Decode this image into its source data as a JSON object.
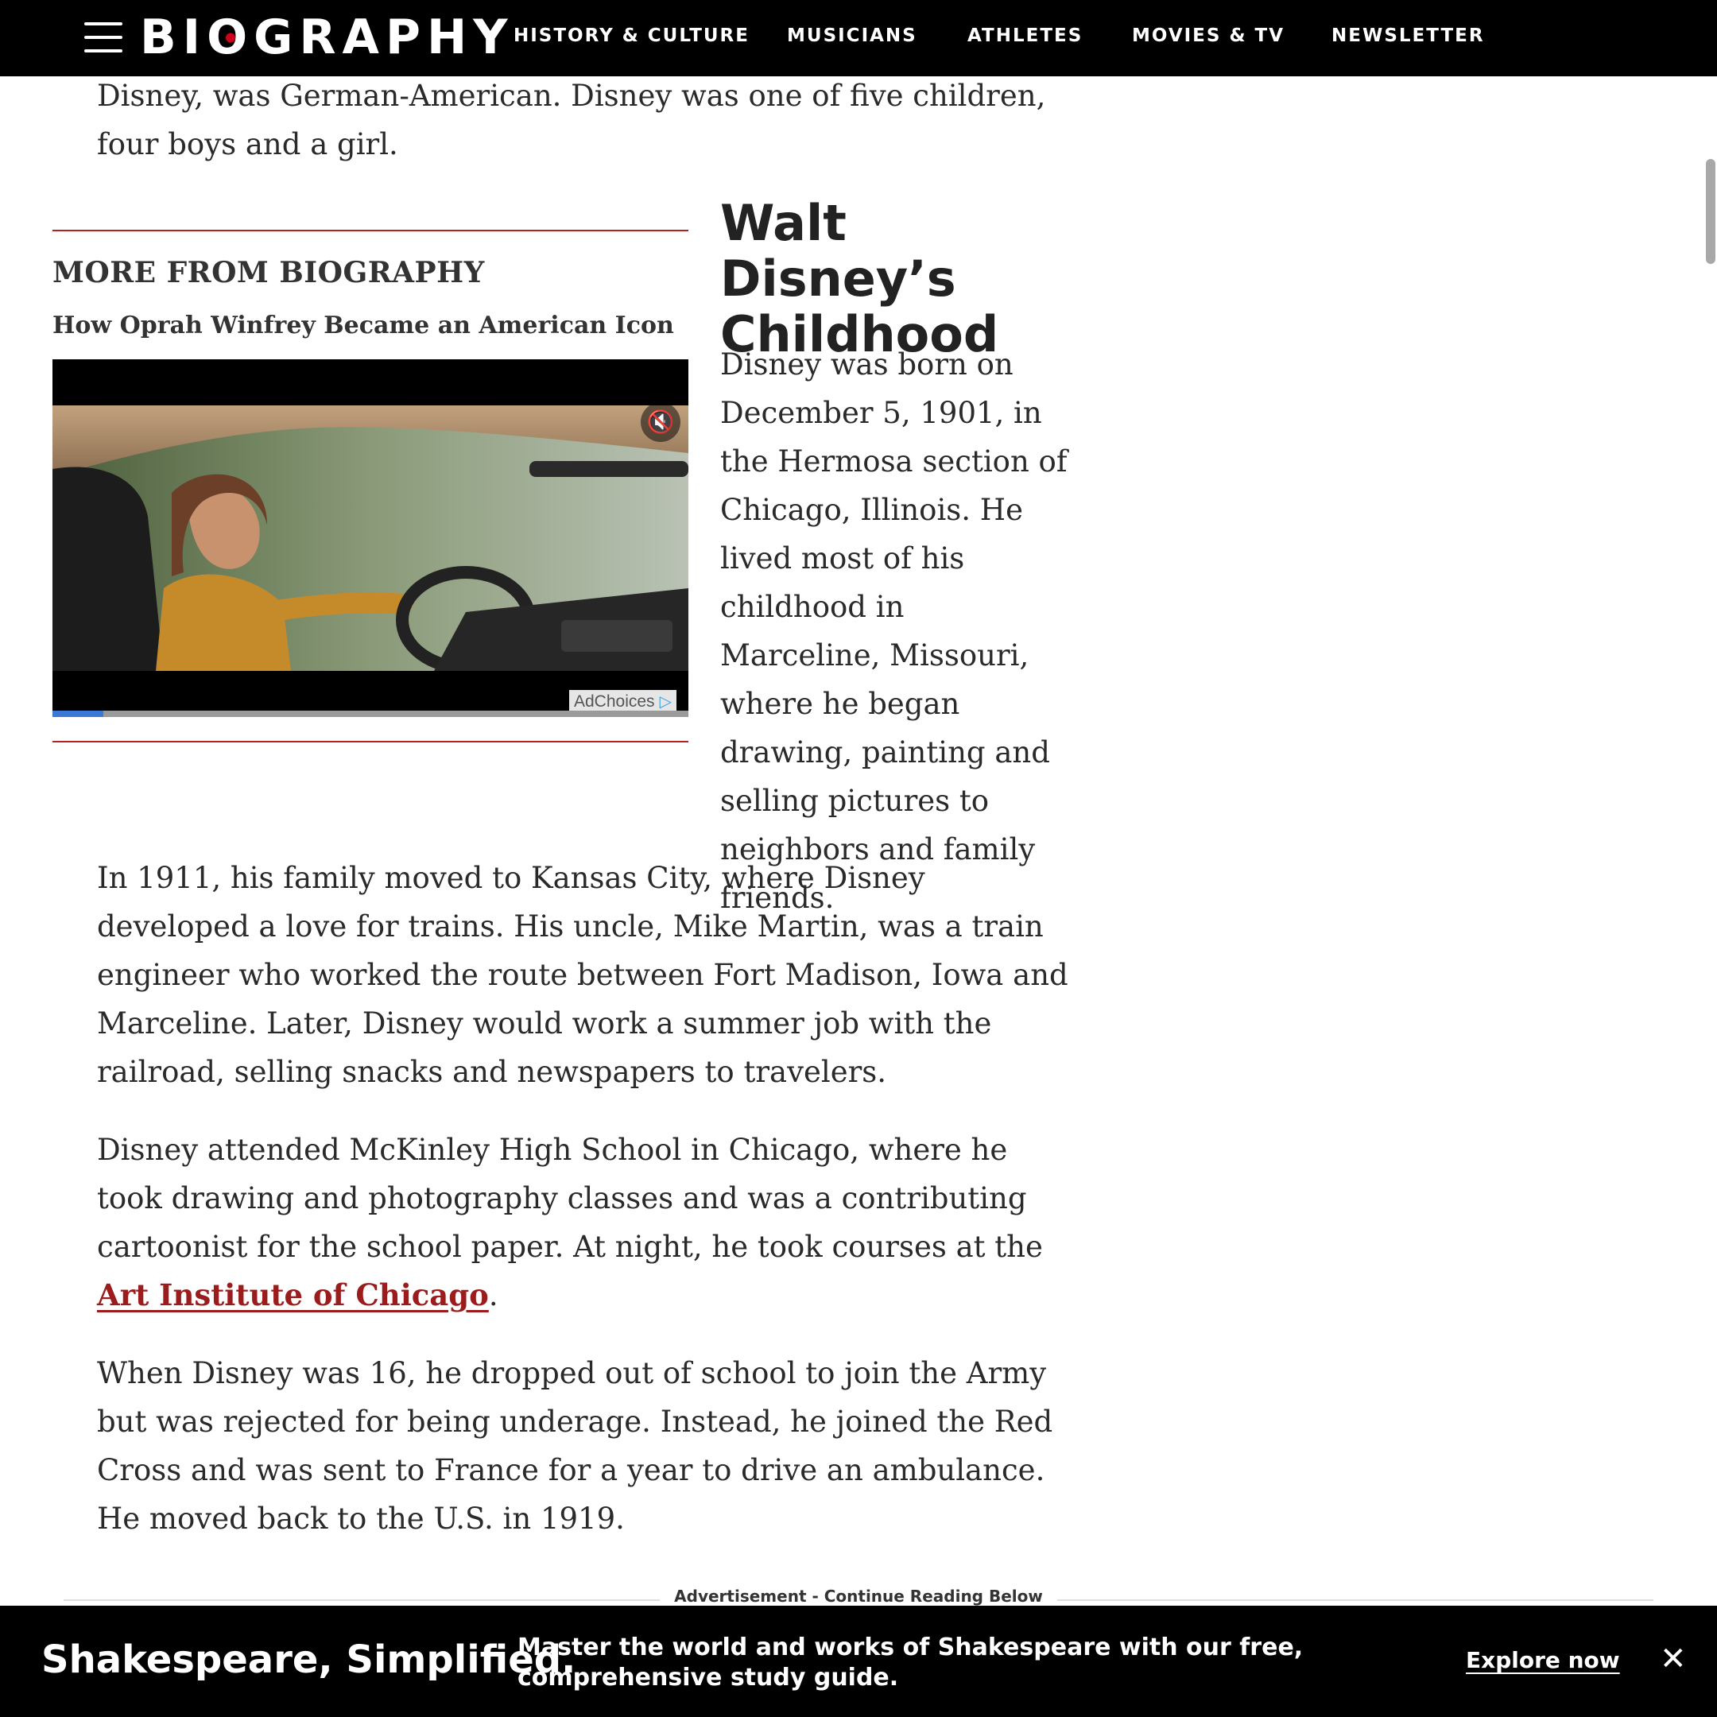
{
  "header": {
    "logo": "BIOGRAPHY",
    "nav": [
      "HISTORY & CULTURE",
      "MUSICIANS",
      "ATHLETES",
      "MOVIES & TV",
      "NEWSLETTER"
    ]
  },
  "article": {
    "intro": "Disney, was German-American. Disney was one of five children, four boys and a girl.",
    "section_heading": "Walt Disney’s Childhood",
    "aside_paragraph": "Disney was born on December 5, 1901, in the Hermosa section of Chicago, Illinois. He lived most of his childhood in Marceline, Missouri, where he began drawing, painting and selling pictures to neighbors and family friends.",
    "paragraph_2": "In 1911, his family moved to Kansas City, where Disney developed a love for trains. His uncle, Mike Martin, was a train engineer who worked the route between Fort Madison, Iowa and Marceline. Later, Disney would work a summer job with the railroad, selling snacks and newspapers to travelers.",
    "paragraph_3_before": "Disney attended McKinley High School in Chicago, where he took drawing and photography classes and was a contributing cartoonist for the school paper. At night, he took courses at the ",
    "paragraph_3_link": "Art Institute of Chicago",
    "paragraph_3_after": ".",
    "paragraph_4": "When Disney was 16, he dropped out of school to join the Army but was rejected for being underage. Instead, he joined the Red Cross and was sent to France for a year to drive an ambulance. He moved back to the U.S. in 1919."
  },
  "more_from": {
    "label": "MORE FROM BIOGRAPHY",
    "video_title": "How Oprah Winfrey Became an American Icon",
    "ad_choices": "AdChoices",
    "mute_icon": "muted-speaker-icon",
    "progress": 0.08
  },
  "ad": {
    "label": "Advertisement - Continue Reading Below"
  },
  "banner": {
    "title": "Shakespeare, Simplified.",
    "description": "Master the world and works of Shakespeare with our free, comprehensive study guide.",
    "cta": "Explore now",
    "close_icon": "close-icon"
  },
  "colors": {
    "accent_red": "#b22222",
    "link_red": "#9b1c1c",
    "progress_blue": "#3b78d8"
  }
}
